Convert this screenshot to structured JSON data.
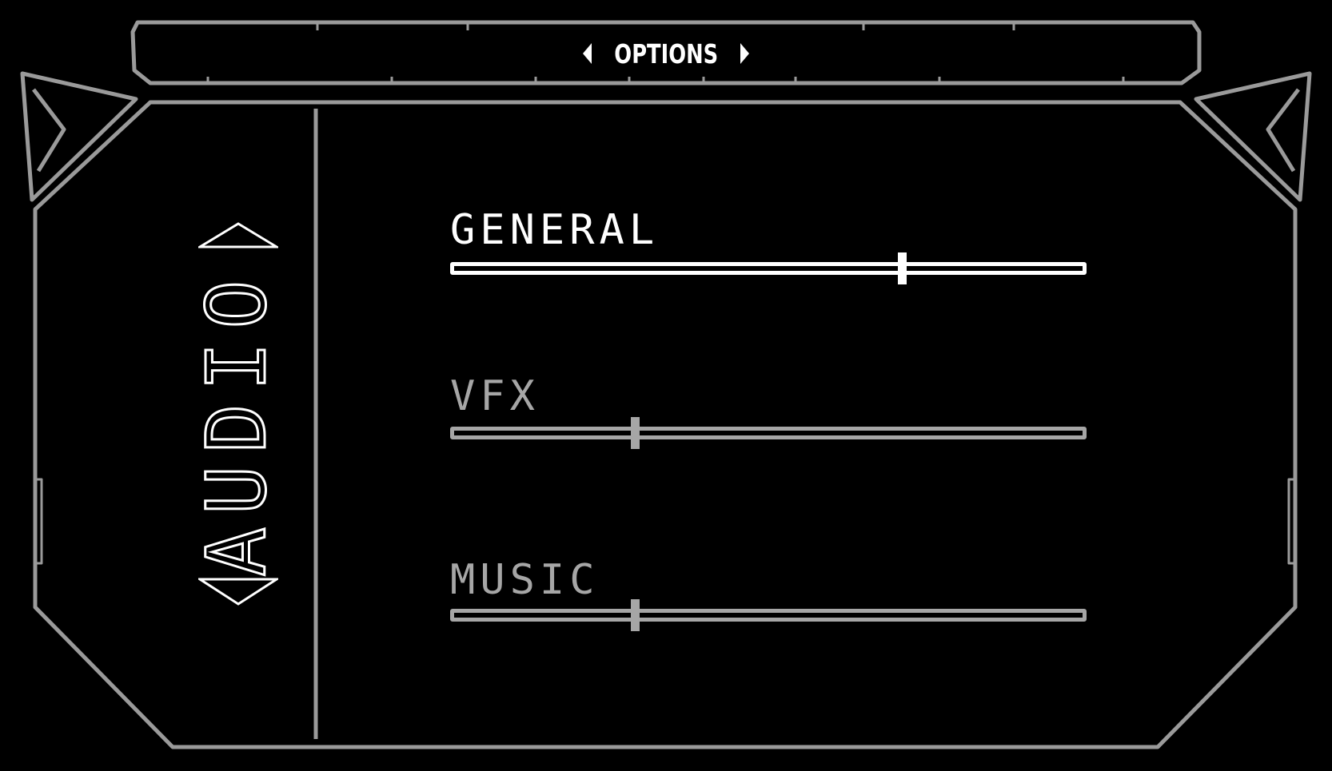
{
  "header": {
    "title": "OPTIONS",
    "prev_icon": "caret-left-icon",
    "next_icon": "caret-right-icon"
  },
  "category": {
    "label": "AUDIO",
    "up_icon": "triangle-up-icon",
    "down_icon": "triangle-down-icon"
  },
  "settings": [
    {
      "label": "GENERAL",
      "value": 0.71,
      "state": "selected"
    },
    {
      "label": "VFX",
      "value": 0.29,
      "state": "unselected"
    },
    {
      "label": "MUSIC",
      "value": 0.29,
      "state": "unselected"
    }
  ],
  "colors": {
    "background": "#000000",
    "frame": "#9a9a9a",
    "active": "#ffffff",
    "inactive": "#a6a6a6"
  }
}
